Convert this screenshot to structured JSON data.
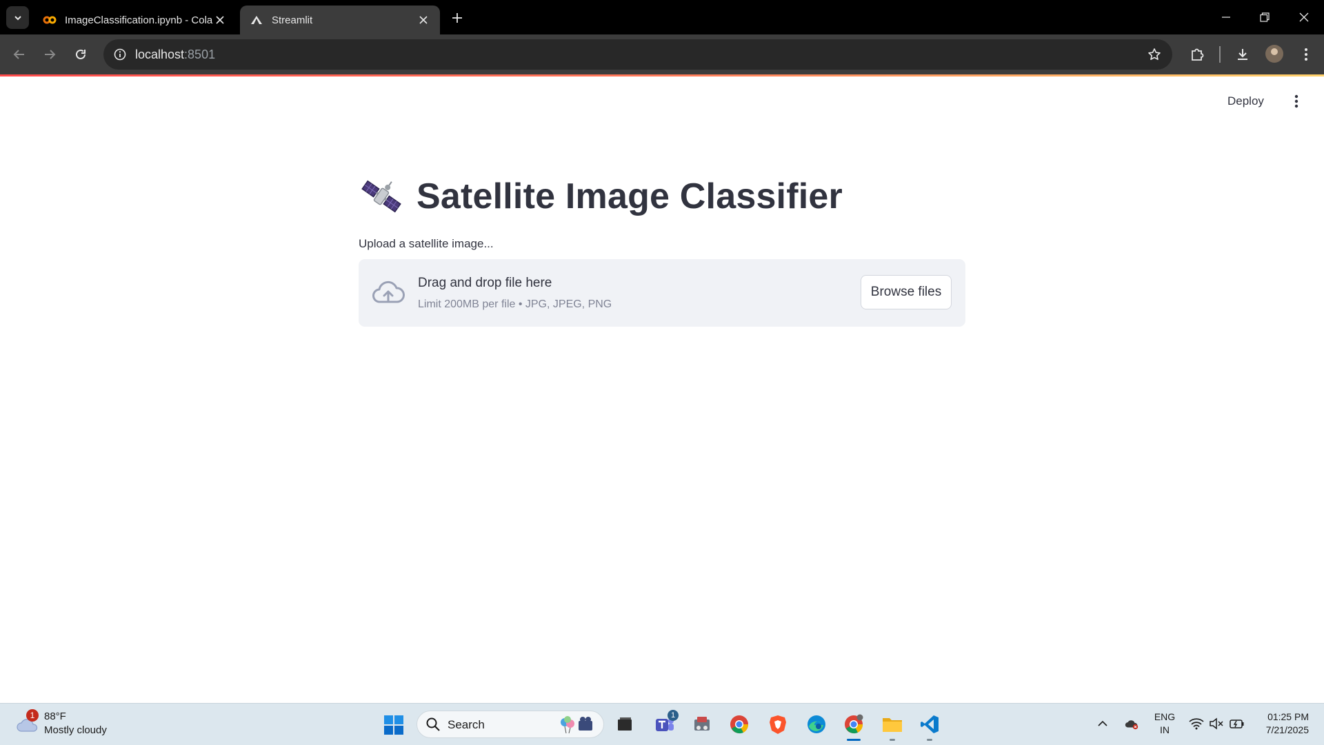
{
  "browser": {
    "tabs": [
      {
        "title": "ImageClassification.ipynb - Colab",
        "active": false
      },
      {
        "title": "Streamlit",
        "active": true
      }
    ],
    "url_host": "localhost",
    "url_port": ":8501"
  },
  "app": {
    "deploy_label": "Deploy",
    "title": "Satellite Image Classifier",
    "uploader": {
      "label": "Upload a satellite image...",
      "drop_text": "Drag and drop file here",
      "limit_text": "Limit 200MB per file • JPG, JPEG, PNG",
      "browse_label": "Browse files"
    }
  },
  "taskbar": {
    "weather": {
      "badge": "1",
      "temp": "88°F",
      "desc": "Mostly cloudy"
    },
    "search_placeholder": "Search",
    "teams_badge": "1",
    "lang_line1": "ENG",
    "lang_line2": "IN",
    "time": "01:25 PM",
    "date": "7/21/2025"
  },
  "colors": {
    "accent": "#ff4b4b",
    "text": "#31333f",
    "dropzone_bg": "#f0f2f6",
    "taskbar_bg": "#dce7ee"
  }
}
